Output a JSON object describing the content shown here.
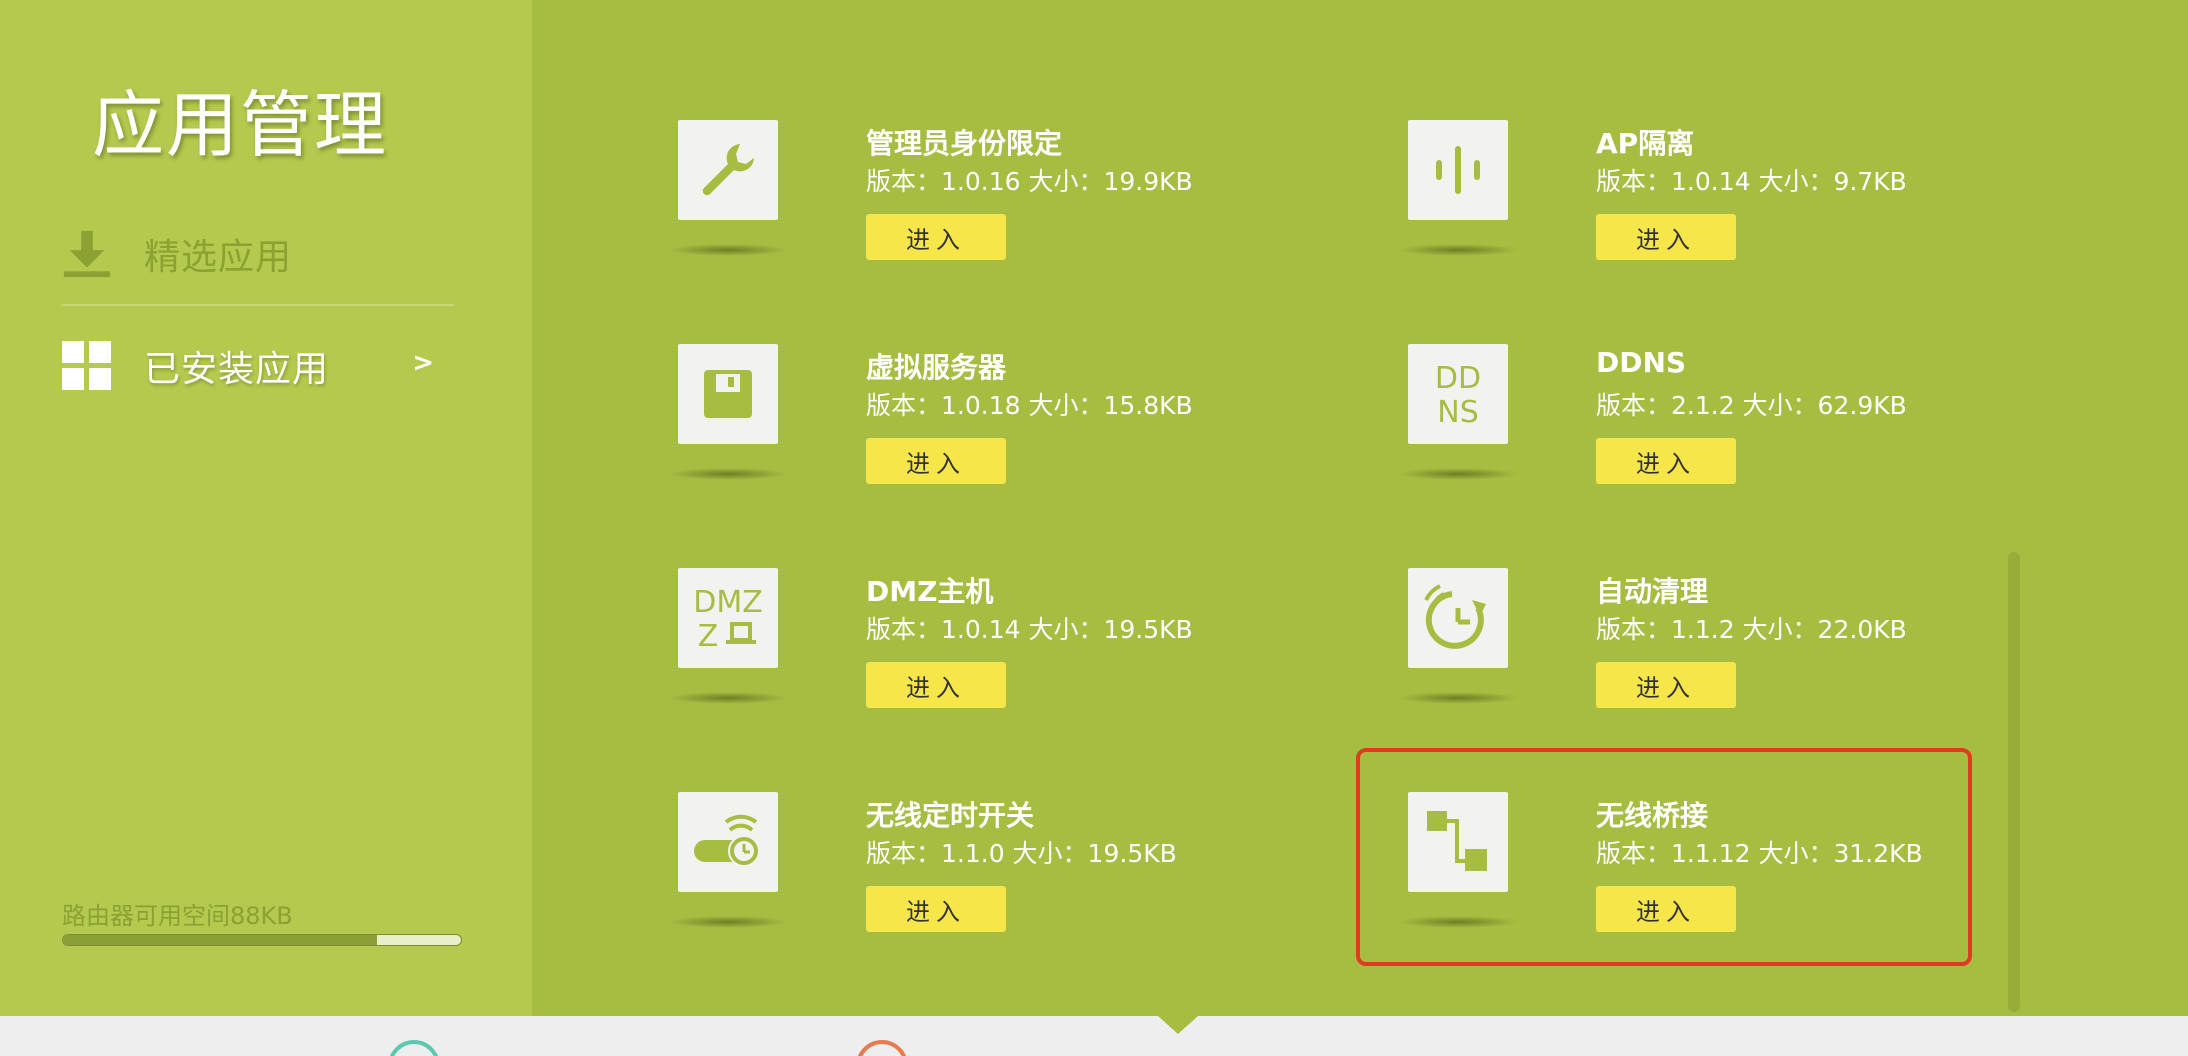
{
  "sidebar": {
    "title": "应用管理",
    "nav": {
      "featured_label": "精选应用",
      "installed_label": "已安装应用",
      "installed_arrow": ">"
    },
    "storage": {
      "text": "路由器可用空间88KB",
      "used_fraction": 0.79
    }
  },
  "apps": [
    {
      "name": "管理员身份限定",
      "meta": "版本：1.0.16 大小：19.9KB",
      "icon": "wrench-icon",
      "button": "进入"
    },
    {
      "name": "AP隔离",
      "meta": "版本：1.0.14 大小：9.7KB",
      "icon": "isolation-icon",
      "button": "进入"
    },
    {
      "name": "虚拟服务器",
      "meta": "版本：1.0.18 大小：15.8KB",
      "icon": "server-icon",
      "button": "进入"
    },
    {
      "name": "DDNS",
      "meta": "版本：2.1.2 大小：62.9KB",
      "icon": "ddns-icon",
      "icon_text": [
        "DD",
        "NS"
      ],
      "button": "进入"
    },
    {
      "name": "DMZ主机",
      "meta": "版本：1.0.14 大小：19.5KB",
      "icon": "dmz-icon",
      "icon_text": [
        "DMZ",
        "Z"
      ],
      "button": "进入"
    },
    {
      "name": "自动清理",
      "meta": "版本：1.1.2 大小：22.0KB",
      "icon": "auto-clean-icon",
      "button": "进入"
    },
    {
      "name": "无线定时开关",
      "meta": "版本：1.1.0 大小：19.5KB",
      "icon": "wifi-timer-icon",
      "button": "进入"
    },
    {
      "name": "无线桥接",
      "meta": "版本：1.1.12 大小：31.2KB",
      "icon": "wireless-bridge-icon",
      "button": "进入"
    }
  ],
  "colors": {
    "sidebar_bg": "#b4c94d",
    "main_bg": "#a6bd42",
    "button_bg": "#f7e64a",
    "highlight": "#e03a20",
    "icon_color": "#a6bd42"
  }
}
